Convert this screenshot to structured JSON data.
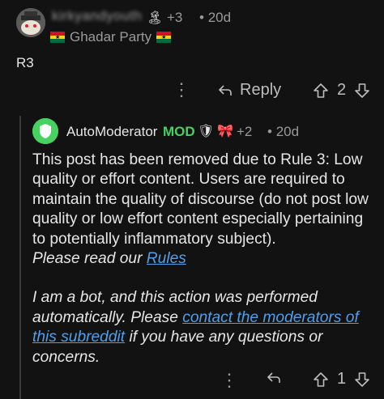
{
  "comment": {
    "username": "kirkyandyouth",
    "award_count": "+3",
    "time": "20d",
    "flair": "Ghadar Party",
    "body": "R3",
    "more_label": "⋮",
    "reply_label": "Reply",
    "score": "2"
  },
  "reply": {
    "username": "AutoModerator",
    "badge": "MOD",
    "award_count": "+2",
    "time": "20d",
    "paragraph1": "This post has been removed due to Rule 3:  Low quality or effort content. Users are required to maintain the quality of discourse (do not post low quality or low effort content especially pertaining to potentially inflammatory subject).",
    "paragraph2_prefix": "Please read our ",
    "rules_link": "Rules",
    "paragraph3_prefix": "I am a bot, and this action was performed automatically. Please ",
    "contact_link": "contact the moderators of this subreddit",
    "paragraph3_suffix": " if you have any questions or concerns.",
    "more_label": "⋮",
    "score": "1"
  },
  "colors": {
    "background": "#121212",
    "mod_green": "#46d160",
    "link_blue": "#4f9fe9",
    "muted": "#9a9a9a"
  }
}
